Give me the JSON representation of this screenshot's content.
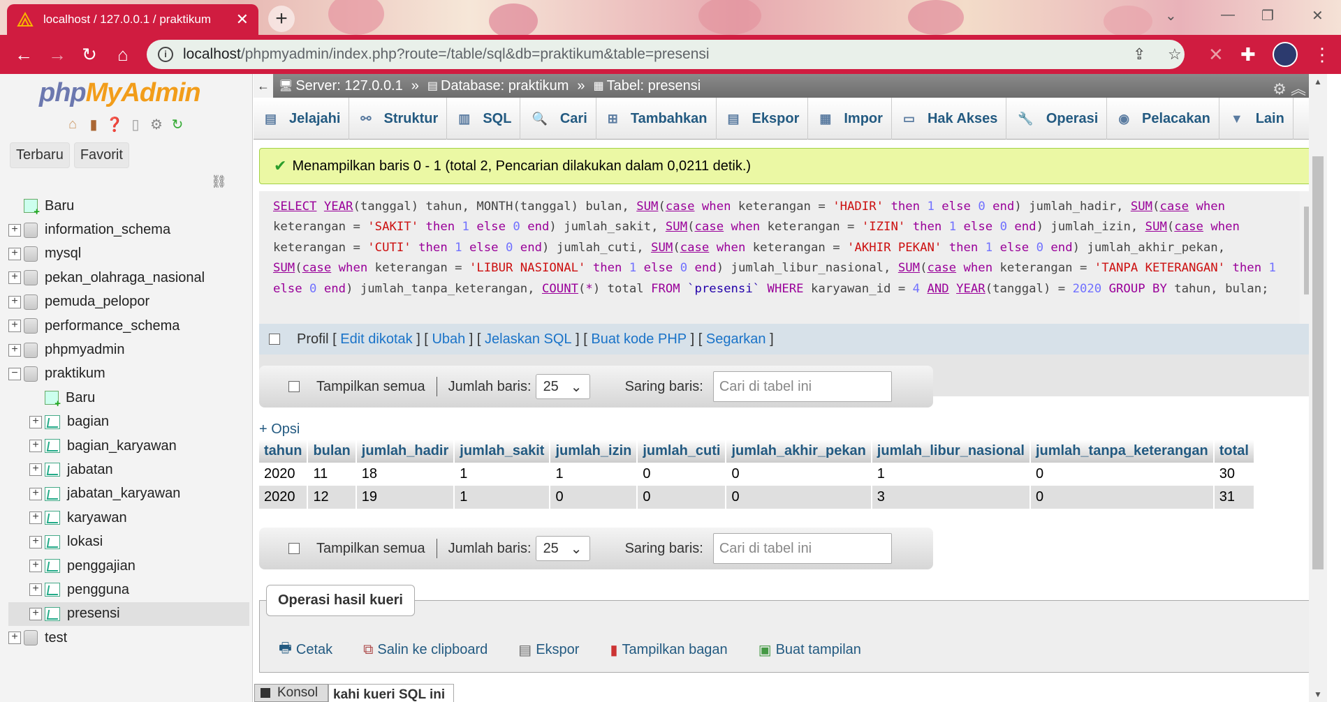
{
  "browser": {
    "tab_title": "localhost / 127.0.0.1 / praktikum",
    "url_host": "localhost",
    "url_path": "/phpmyadmin/index.php?route=/table/sql&db=praktikum&table=presensi"
  },
  "left": {
    "logo_php": "php",
    "logo_myadmin": "MyAdmin",
    "tab_recent": "Terbaru",
    "tab_favorites": "Favorit",
    "tree": [
      {
        "label": "Baru",
        "level": 1,
        "kind": "new"
      },
      {
        "label": "information_schema",
        "level": 1,
        "kind": "db"
      },
      {
        "label": "mysql",
        "level": 1,
        "kind": "db"
      },
      {
        "label": "pekan_olahraga_nasional",
        "level": 1,
        "kind": "db"
      },
      {
        "label": "pemuda_pelopor",
        "level": 1,
        "kind": "db"
      },
      {
        "label": "performance_schema",
        "level": 1,
        "kind": "db"
      },
      {
        "label": "phpmyadmin",
        "level": 1,
        "kind": "db"
      },
      {
        "label": "praktikum",
        "level": 1,
        "kind": "db-open"
      },
      {
        "label": "Baru",
        "level": 2,
        "kind": "new"
      },
      {
        "label": "bagian",
        "level": 2,
        "kind": "table"
      },
      {
        "label": "bagian_karyawan",
        "level": 2,
        "kind": "table"
      },
      {
        "label": "jabatan",
        "level": 2,
        "kind": "table"
      },
      {
        "label": "jabatan_karyawan",
        "level": 2,
        "kind": "table"
      },
      {
        "label": "karyawan",
        "level": 2,
        "kind": "table"
      },
      {
        "label": "lokasi",
        "level": 2,
        "kind": "table"
      },
      {
        "label": "penggajian",
        "level": 2,
        "kind": "table"
      },
      {
        "label": "pengguna",
        "level": 2,
        "kind": "table"
      },
      {
        "label": "presensi",
        "level": 2,
        "kind": "table",
        "selected": true
      },
      {
        "label": "test",
        "level": 1,
        "kind": "db"
      }
    ]
  },
  "breadcrumb": {
    "server": "Server: 127.0.0.1",
    "database": "Database: praktikum",
    "table": "Tabel: presensi",
    "sep": "»"
  },
  "menu": [
    {
      "label": "Jelajahi",
      "icon": "browse-icon"
    },
    {
      "label": "Struktur",
      "icon": "structure-icon"
    },
    {
      "label": "SQL",
      "icon": "sql-icon"
    },
    {
      "label": "Cari",
      "icon": "search-icon"
    },
    {
      "label": "Tambahkan",
      "icon": "insert-icon"
    },
    {
      "label": "Ekspor",
      "icon": "export-icon"
    },
    {
      "label": "Impor",
      "icon": "import-icon"
    },
    {
      "label": "Hak Akses",
      "icon": "privileges-icon"
    },
    {
      "label": "Operasi",
      "icon": "operations-icon"
    },
    {
      "label": "Pelacakan",
      "icon": "tracking-icon"
    },
    {
      "label": "Lain",
      "icon": "more-icon"
    }
  ],
  "result_message": "Menampilkan baris 0 - 1 (total 2, Pencarian dilakukan dalam 0,0211 detik.)",
  "sql_actions": {
    "profile": "Profil",
    "edit_inline": "Edit dikotak",
    "edit": "Ubah",
    "explain": "Jelaskan SQL",
    "php_code": "Buat kode PHP",
    "refresh": "Segarkan"
  },
  "filter": {
    "show_all": "Tampilkan semua",
    "rows_label": "Jumlah baris:",
    "rows_value": "25",
    "filter_label": "Saring baris:",
    "filter_placeholder": "Cari di tabel ini"
  },
  "options_link": "+ Opsi",
  "table": {
    "columns": [
      "tahun",
      "bulan",
      "jumlah_hadir",
      "jumlah_sakit",
      "jumlah_izin",
      "jumlah_cuti",
      "jumlah_akhir_pekan",
      "jumlah_libur_nasional",
      "jumlah_tanpa_keterangan",
      "total"
    ],
    "rows": [
      [
        "2020",
        "11",
        "18",
        "1",
        "1",
        "0",
        "0",
        "1",
        "0",
        "30"
      ],
      [
        "2020",
        "12",
        "19",
        "1",
        "0",
        "0",
        "0",
        "3",
        "0",
        "31"
      ]
    ]
  },
  "query_ops": {
    "title": "Operasi hasil kueri",
    "print": "Cetak",
    "copy": "Salin ke clipboard",
    "export": "Ekspor",
    "chart": "Tampilkan bagan",
    "view": "Buat tampilan"
  },
  "console": "Konsol",
  "partial_heading": "kahi kueri SQL ini",
  "colors": {
    "chrome_red": "#d01c40",
    "link_blue": "#235a81",
    "success_bg": "#ebf8a4"
  }
}
